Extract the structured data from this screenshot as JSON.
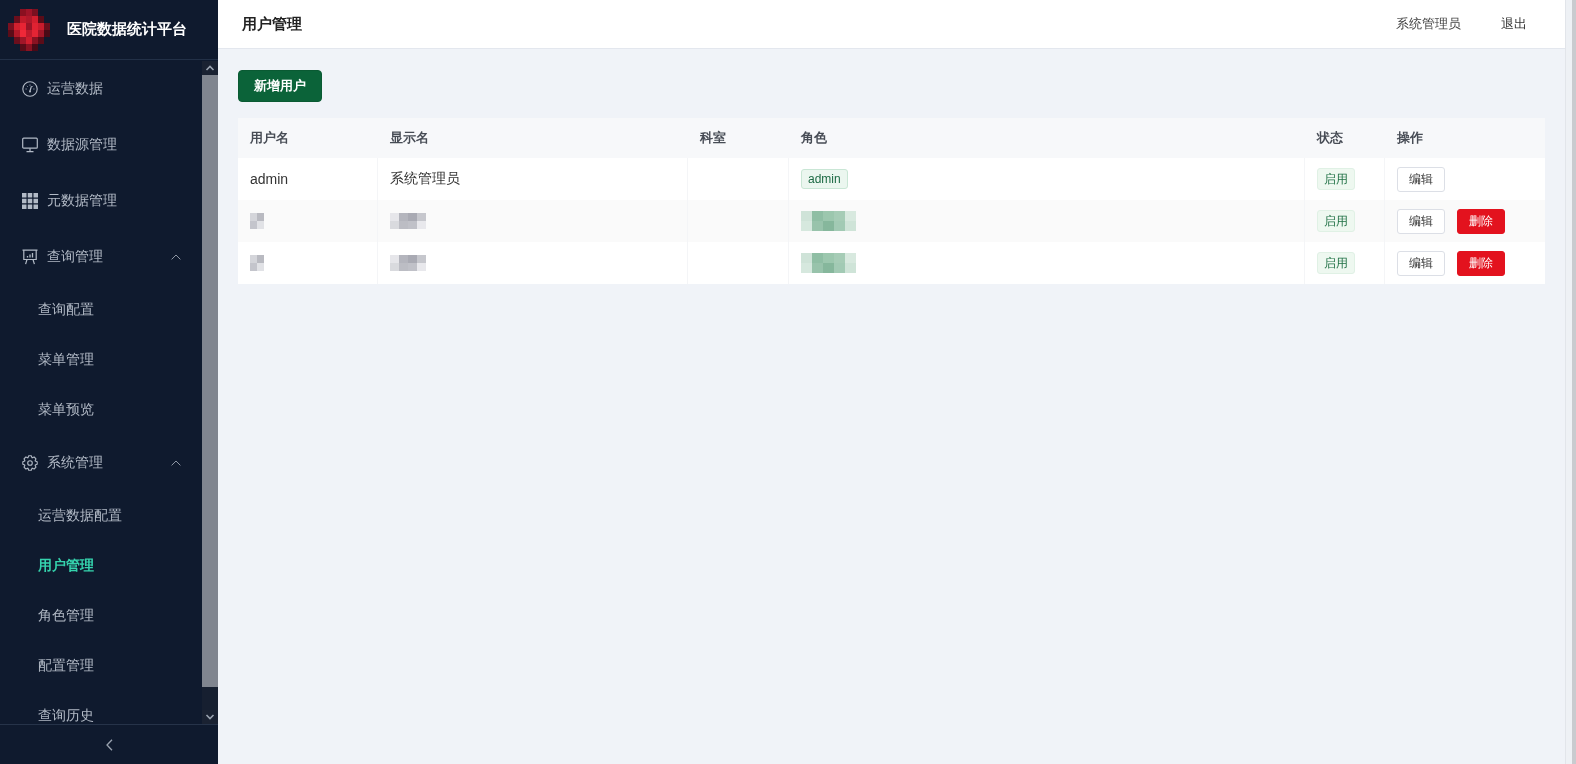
{
  "sidebar": {
    "title": "医院数据统计平台",
    "menu": [
      {
        "kind": "gauge",
        "label": "运营数据",
        "selected": false
      },
      {
        "kind": "monitor",
        "label": "数据源管理",
        "selected": false
      },
      {
        "kind": "grid",
        "label": "元数据管理",
        "selected": false
      },
      {
        "kind": "board",
        "label": "查询管理",
        "selected": false,
        "expanded": true,
        "children": [
          {
            "label": "查询配置",
            "selected": false
          },
          {
            "label": "菜单管理",
            "selected": false
          },
          {
            "label": "菜单预览",
            "selected": false
          }
        ]
      },
      {
        "kind": "gear",
        "label": "系统管理",
        "selected": false,
        "expanded": true,
        "children": [
          {
            "label": "运营数据配置",
            "selected": false
          },
          {
            "label": "用户管理",
            "selected": true
          },
          {
            "label": "角色管理",
            "selected": false
          },
          {
            "label": "配置管理",
            "selected": false
          },
          {
            "label": "查询历史",
            "selected": false
          }
        ]
      }
    ]
  },
  "header": {
    "title": "用户管理",
    "user": "系统管理员",
    "logout": "退出"
  },
  "toolbar": {
    "add_button": "新增用户"
  },
  "table": {
    "columns": [
      "用户名",
      "显示名",
      "科室",
      "角色",
      "状态",
      "操作"
    ],
    "rows": [
      {
        "redacted": false,
        "username": "admin",
        "display_name": "系统管理员",
        "role": "admin",
        "status": "启用",
        "actions": [
          {
            "kind": "edit",
            "label": "编辑"
          }
        ]
      },
      {
        "redacted": true,
        "status": "启用",
        "actions": [
          {
            "kind": "edit",
            "label": "编辑"
          },
          {
            "kind": "delete",
            "label": "删除"
          }
        ]
      },
      {
        "redacted": true,
        "status": "启用",
        "actions": [
          {
            "kind": "edit",
            "label": "编辑"
          },
          {
            "kind": "delete",
            "label": "删除"
          }
        ]
      }
    ]
  }
}
